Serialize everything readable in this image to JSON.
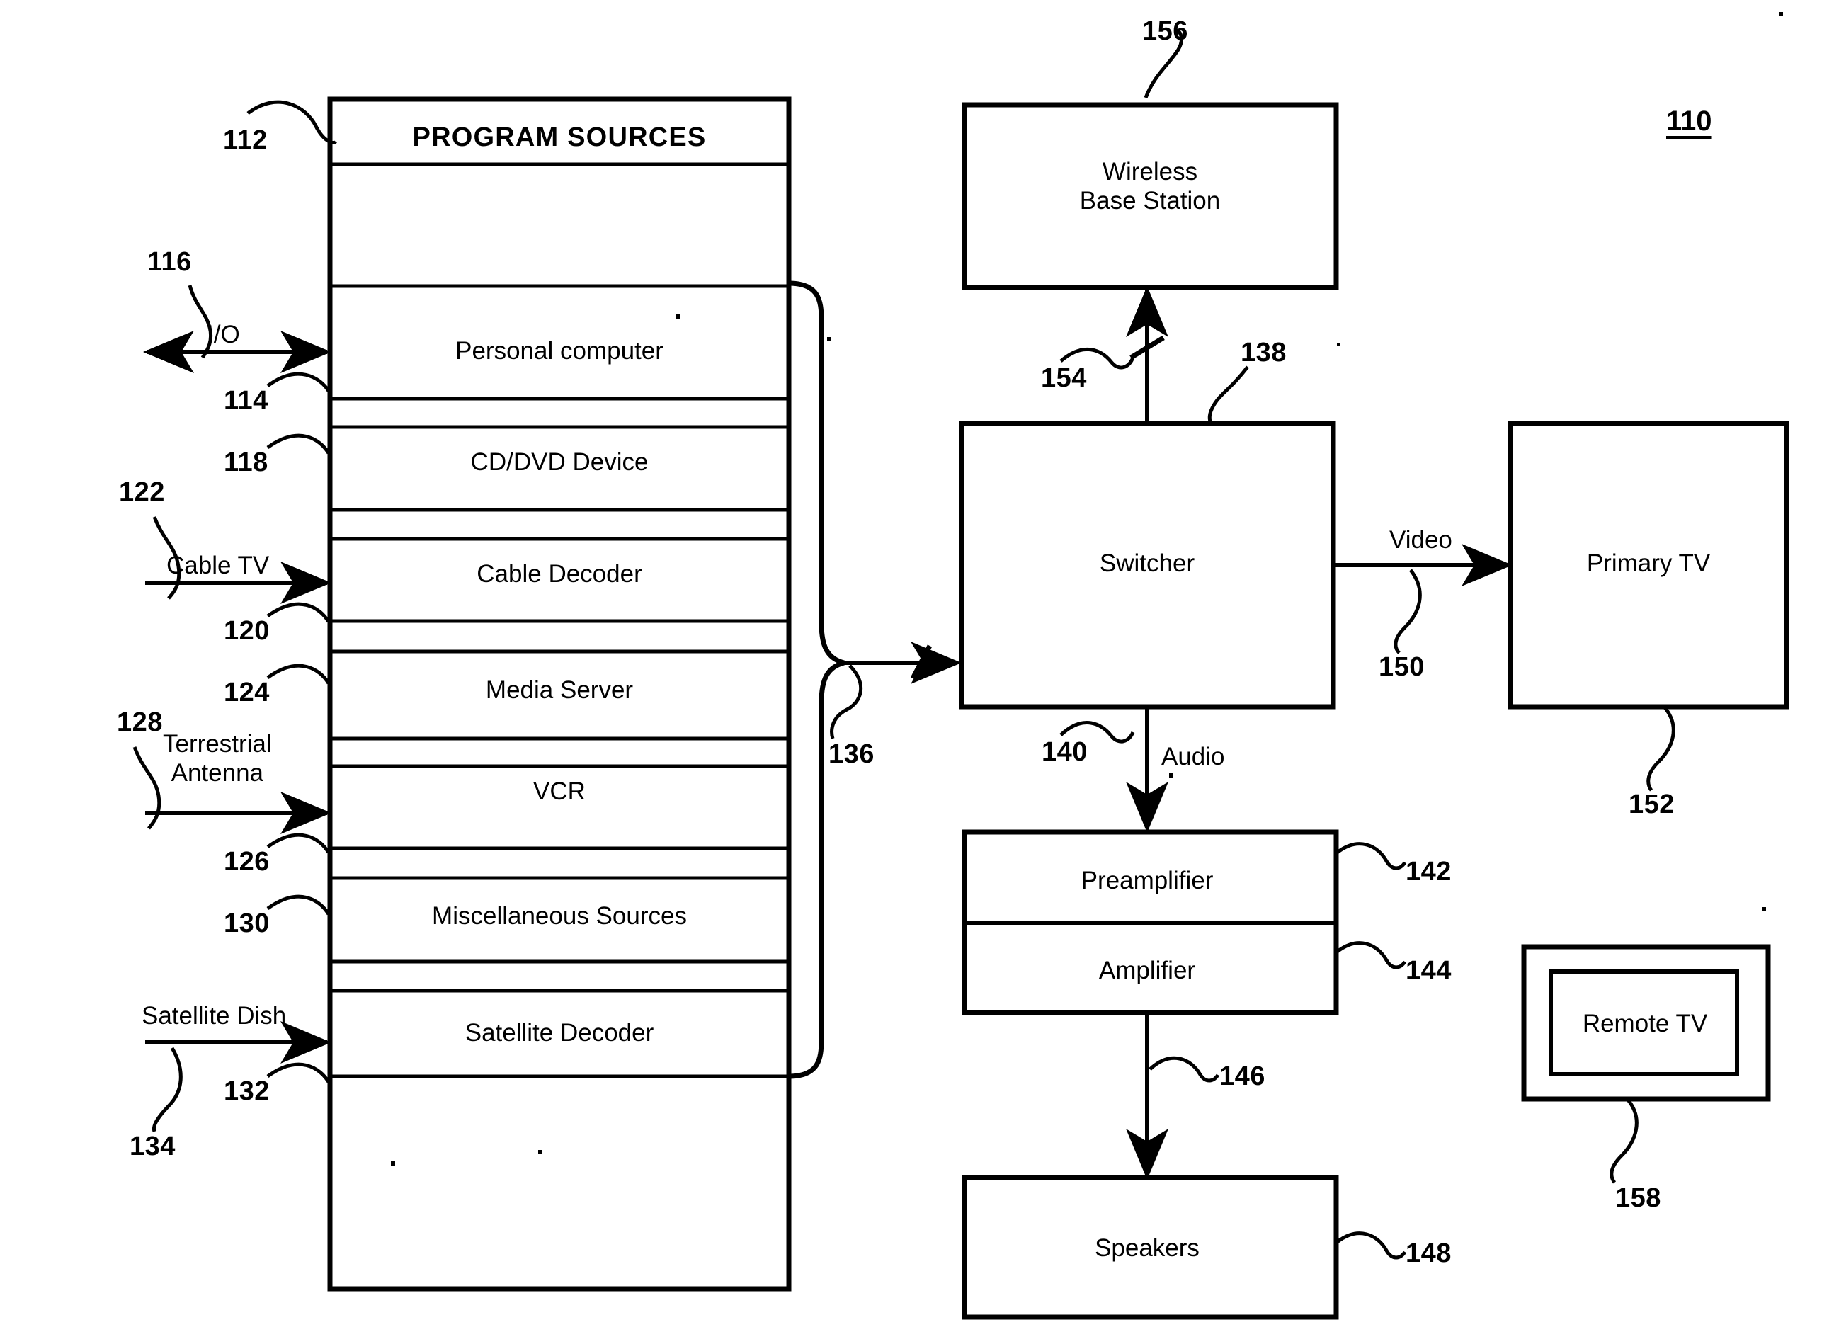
{
  "figure": {
    "id_label": "110",
    "type": "patent-block-diagram"
  },
  "program_sources": {
    "title": "PROGRAM SOURCES",
    "ref": "112",
    "rows": [
      {
        "label": "Personal computer",
        "ref": "114"
      },
      {
        "label": "CD/DVD Device",
        "ref": "118"
      },
      {
        "label": "Cable Decoder",
        "ref": "120"
      },
      {
        "label": "Media Server",
        "ref": "124"
      },
      {
        "label": "VCR",
        "ref": "126"
      },
      {
        "label": "Miscellaneous Sources",
        "ref": "130"
      },
      {
        "label": "Satellite Decoder",
        "ref": "132"
      }
    ]
  },
  "inputs": [
    {
      "name": "I/O",
      "ref": "116",
      "bidirectional": true
    },
    {
      "name": "Cable TV",
      "ref": "122",
      "bidirectional": false
    },
    {
      "name": "Terrestrial\nAntenna",
      "ref": "128",
      "bidirectional": false
    },
    {
      "name": "Satellite Dish",
      "ref": "134",
      "bidirectional": false
    }
  ],
  "bus": {
    "ref": "136"
  },
  "blocks": {
    "wireless_base_station": {
      "label": "Wireless\nBase Station",
      "ref": "156"
    },
    "switcher": {
      "label": "Switcher",
      "ref": "138"
    },
    "primary_tv": {
      "label": "Primary TV",
      "ref": "152"
    },
    "preamplifier": {
      "label": "Preamplifier",
      "ref": "142"
    },
    "amplifier": {
      "label": "Amplifier",
      "ref": "144"
    },
    "speakers": {
      "label": "Speakers",
      "ref": "148"
    },
    "remote_tv": {
      "label": "Remote TV",
      "ref": "158"
    }
  },
  "connections": {
    "switcher_to_base_station": {
      "ref": "154"
    },
    "switcher_to_primary_tv": {
      "label": "Video",
      "ref": "150"
    },
    "switcher_to_preamp": {
      "label": "Audio",
      "ref": "140"
    },
    "amplifier_to_speakers": {
      "ref": "146"
    }
  },
  "colors": {
    "ink": "#000000",
    "paper": "#ffffff"
  }
}
